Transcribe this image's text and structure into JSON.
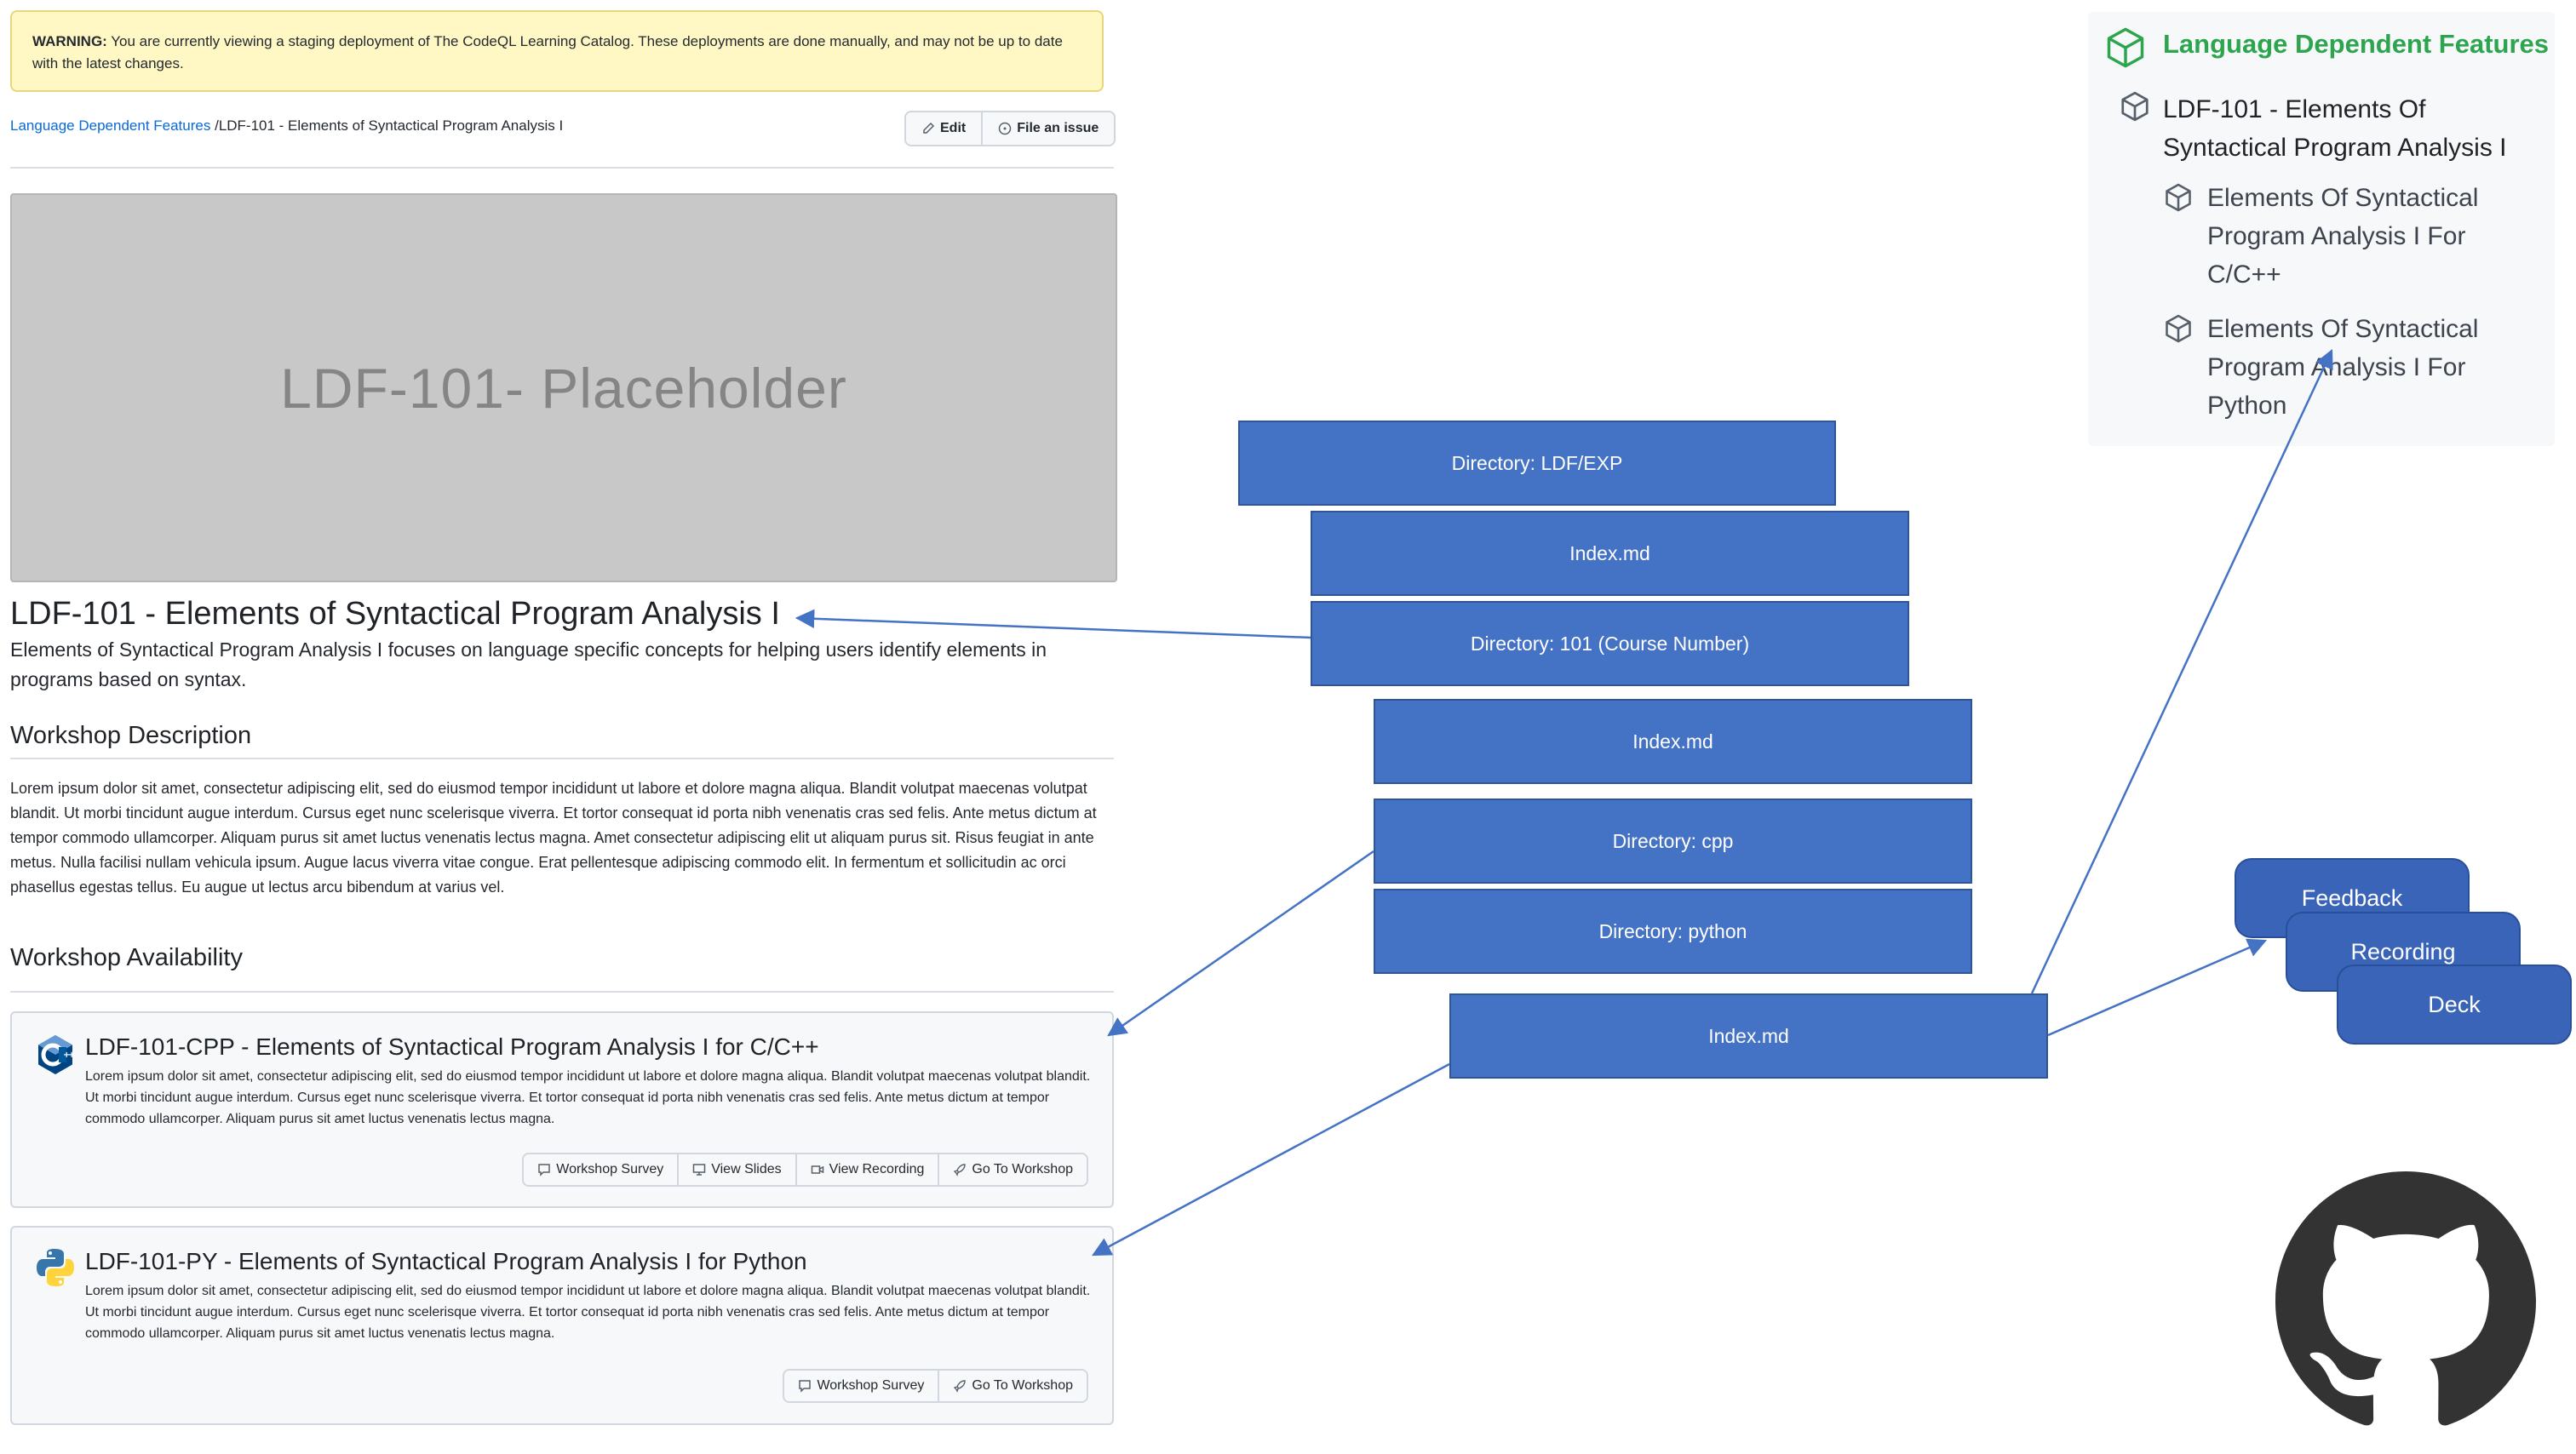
{
  "warning": {
    "label": "WARNING:",
    "text": " You are currently viewing a staging deployment of The CodeQL Learning Catalog. These deployments are done manually, and may not be up to date with the latest changes."
  },
  "breadcrumb": {
    "parent": "Language Dependent Features",
    "separator": " /",
    "current": "LDF-101 - Elements of Syntactical Program Analysis I"
  },
  "toolbar": {
    "edit_label": "Edit",
    "issue_label": "File an issue"
  },
  "placeholder": {
    "text": "LDF-101- Placeholder"
  },
  "page": {
    "title": "LDF-101 - Elements of Syntactical Program Analysis I",
    "description": "Elements of Syntactical Program Analysis I focuses on language specific concepts for helping users identify elements in programs based on syntax."
  },
  "workshop_description": {
    "heading": "Workshop Description",
    "body": "Lorem ipsum dolor sit amet, consectetur adipiscing elit, sed do eiusmod tempor incididunt ut labore et dolore magna aliqua. Blandit volutpat maecenas volutpat blandit. Ut morbi tincidunt augue interdum. Cursus eget nunc scelerisque viverra. Et tortor consequat id porta nibh venenatis cras sed felis. Ante metus dictum at tempor commodo ullamcorper. Aliquam purus sit amet luctus venenatis lectus magna. Amet consectetur adipiscing elit ut aliquam purus sit. Risus feugiat in ante metus. Nulla facilisi nullam vehicula ipsum. Augue lacus viverra vitae congue. Erat pellentesque adipiscing commodo elit. In fermentum et sollicitudin ac orci phasellus egestas tellus. Eu augue ut lectus arcu bibendum at varius vel."
  },
  "workshop_availability": {
    "heading": "Workshop Availability",
    "cards": [
      {
        "title": "LDF-101-CPP - Elements of Syntactical Program Analysis I for C/C++",
        "body": "Lorem ipsum dolor sit amet, consectetur adipiscing elit, sed do eiusmod tempor incididunt ut labore et dolore magna aliqua. Blandit volutpat maecenas volutpat blandit. Ut morbi tincidunt augue interdum. Cursus eget nunc scelerisque viverra. Et tortor consequat id porta nibh venenatis cras sed felis. Ante metus dictum at tempor commodo ullamcorper. Aliquam purus sit amet luctus venenatis lectus magna.",
        "icon": "cpp-logo-icon",
        "buttons": [
          "Workshop Survey",
          "View Slides",
          "View Recording",
          "Go To Workshop"
        ]
      },
      {
        "title": "LDF-101-PY - Elements of Syntactical Program Analysis I for Python",
        "body": "Lorem ipsum dolor sit amet, consectetur adipiscing elit, sed do eiusmod tempor incididunt ut labore et dolore magna aliqua. Blandit volutpat maecenas volutpat blandit. Ut morbi tincidunt augue interdum. Cursus eget nunc scelerisque viverra. Et tortor consequat id porta nibh venenatis cras sed felis. Ante metus dictum at tempor commodo ullamcorper. Aliquam purus sit amet luctus venenatis lectus magna.",
        "icon": "python-logo-icon",
        "buttons": [
          "Workshop Survey",
          "Go To Workshop"
        ]
      }
    ]
  },
  "diagram": {
    "boxes": [
      "Directory: LDF/EXP",
      "Index.md",
      "Directory: 101 (Course Number)",
      "Index.md",
      "Directory: cpp",
      "Directory: python",
      "Index.md"
    ],
    "tabs": [
      "Feedback",
      "Recording",
      "Deck"
    ],
    "colors": {
      "box": "#4472c4",
      "arrow": "#4472c4",
      "nav_heading": "#2da44e"
    }
  },
  "nav": {
    "heading": "Language Dependent Features",
    "course": "LDF-101 - Elements Of Syntactical Program Analysis I",
    "items": [
      "Elements Of Syntactical Program Analysis I For C/C++",
      "Elements Of Syntactical Program Analysis I For Python"
    ]
  },
  "logo": {
    "icon": "github-octocat-icon"
  }
}
